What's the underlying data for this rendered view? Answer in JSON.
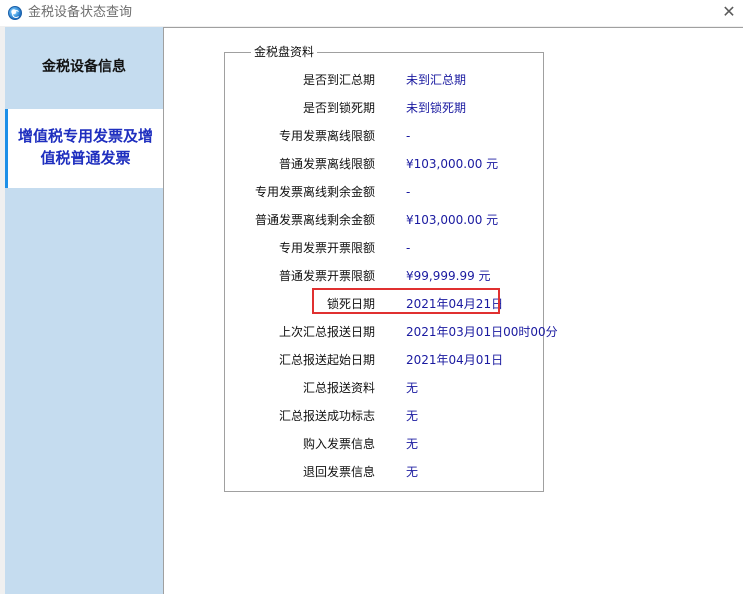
{
  "window": {
    "title": "金税设备状态查询",
    "close_symbol": "✕"
  },
  "sidebar": {
    "items": [
      {
        "label": "金税设备信息",
        "selected": false
      },
      {
        "label": "增值税专用发票及增值税普通发票",
        "selected": true
      }
    ]
  },
  "group": {
    "title": "金税盘资料",
    "rows": [
      {
        "label": "是否到汇总期",
        "value": "未到汇总期"
      },
      {
        "label": "是否到锁死期",
        "value": "未到锁死期"
      },
      {
        "label": "专用发票离线限额",
        "value": "-"
      },
      {
        "label": "普通发票离线限额",
        "value": "¥103,000.00 元"
      },
      {
        "label": "专用发票离线剩余金额",
        "value": "-"
      },
      {
        "label": "普通发票离线剩余金额",
        "value": "¥103,000.00 元"
      },
      {
        "label": "专用发票开票限额",
        "value": "-"
      },
      {
        "label": "普通发票开票限额",
        "value": "¥99,999.99 元"
      },
      {
        "label": "锁死日期",
        "value": "2021年04月21日"
      },
      {
        "label": "上次汇总报送日期",
        "value": "2021年03月01日00时00分"
      },
      {
        "label": "汇总报送起始日期",
        "value": "2021年04月01日"
      },
      {
        "label": "汇总报送资料",
        "value": "无"
      },
      {
        "label": "汇总报送成功标志",
        "value": "无"
      },
      {
        "label": "购入发票信息",
        "value": "无"
      },
      {
        "label": "退回发票信息",
        "value": "无"
      }
    ]
  },
  "colors": {
    "sidebar_bg": "#c5dcef",
    "selected_accent": "#1e90e8",
    "selected_text": "#1f2fbf",
    "value_text": "#1a1aa0",
    "highlight": "#e03030"
  }
}
